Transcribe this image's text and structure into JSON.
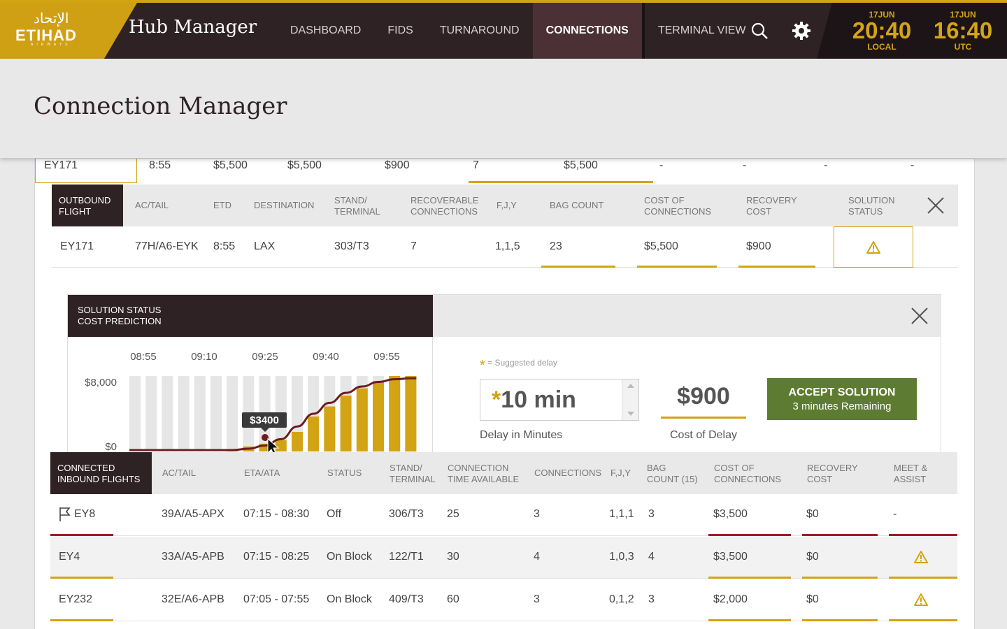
{
  "header": {
    "logo_arabic": "الإتحاد",
    "logo_text": "ETIHAD",
    "logo_sub": "AIRWAYS",
    "app_title": "Hub Manager",
    "nav": [
      "DASHBOARD",
      "FIDS",
      "TURNAROUND",
      "CONNECTIONS",
      "TERMINAL VIEW"
    ],
    "active_nav": "CONNECTIONS",
    "icons": [
      "search-icon",
      "gear-icon"
    ],
    "clocks": [
      {
        "date": "17JUN",
        "time": "20:40",
        "zone": "LOCAL"
      },
      {
        "date": "17JUN",
        "time": "16:40",
        "zone": "UTC"
      }
    ]
  },
  "page": {
    "title": "Connection Manager"
  },
  "summary_row": [
    "EY171",
    "8:55",
    "$5,500",
    "$5,500",
    "$900",
    "7",
    "$5,500",
    "-",
    "-",
    "-",
    "-"
  ],
  "outbound": {
    "label": [
      "OUTBOUND",
      "FLIGHT"
    ],
    "headers": [
      [
        "AC/TAIL"
      ],
      [
        "ETD"
      ],
      [
        "DESTINATION"
      ],
      [
        "STAND/",
        "TERMINAL"
      ],
      [
        "RECOVERABLE",
        "CONNECTIONS"
      ],
      [
        "F,J,Y"
      ],
      [
        "BAG COUNT"
      ],
      [
        "COST OF",
        "CONNECTIONS"
      ],
      [
        "RECOVERY",
        "COST"
      ],
      [
        "SOLUTION",
        "STATUS"
      ]
    ],
    "row": [
      "EY171",
      "77H/A6-EYK",
      "8:55",
      "LAX",
      "303/T3",
      "7",
      "1,1,5",
      "23",
      "$5,500",
      "$900"
    ],
    "status_icon": "warning-icon"
  },
  "prediction": {
    "title": [
      "SOLUTION STATUS",
      "COST PREDICTION"
    ],
    "suggested_note": "= Suggested delay",
    "delay_value": "10 min",
    "delay_star": "*",
    "delay_label": "Delay in Minutes",
    "cost_value": "$900",
    "cost_label": "Cost of Delay",
    "accept_label": "ACCEPT SOLUTION",
    "accept_sub": "3 minutes Remaining",
    "tooltip": "$3400"
  },
  "chart_data": {
    "type": "bar",
    "categories": [
      "08:55",
      "09:10",
      "09:25",
      "09:40",
      "09:55"
    ],
    "y_tick_labels": [
      "$8,000",
      "$0"
    ],
    "ylim": [
      0,
      8000
    ],
    "bar_values": [
      0,
      0,
      0,
      0,
      0,
      0,
      100,
      400,
      700,
      1100,
      2000,
      3700,
      4800,
      6000,
      6800,
      7600,
      8200,
      8600
    ],
    "curve_values": [
      0,
      0,
      0,
      0,
      0,
      0,
      0,
      150,
      500,
      1200,
      2600,
      4000,
      5200,
      6300,
      7000,
      7500,
      7800,
      7900
    ],
    "grid": false,
    "highlight": {
      "label": "$3400"
    }
  },
  "inbound": {
    "label": [
      "CONNECTED",
      "INBOUND FLIGHTS"
    ],
    "headers": [
      [
        "AC/TAIL"
      ],
      [
        "ETA/ATA"
      ],
      [
        "STATUS"
      ],
      [
        "STAND/",
        "TERMINAL"
      ],
      [
        "CONNECTION",
        "TIME AVAILABLE"
      ],
      [
        "CONNECTIONS"
      ],
      [
        "F,J,Y"
      ],
      [
        "BAG",
        "COUNT (15)"
      ],
      [
        "COST OF",
        "CONNECTIONS"
      ],
      [
        "RECOVERY",
        "COST"
      ],
      [
        "MEET &",
        "ASSIST"
      ]
    ],
    "rows": [
      {
        "flight": "EY8",
        "tail": "39A/A5-APX",
        "eta": "07:15 - 08:30",
        "status": "Off",
        "stand": "306/T3",
        "time": "25",
        "conn": "3",
        "fjy": "1,1,1",
        "bags": "3",
        "cost": "$3,500",
        "recovery": "$0",
        "assist": "-",
        "flag": true,
        "color": "red"
      },
      {
        "flight": "EY4",
        "tail": "33A/A5-APB",
        "eta": "07:15 - 08:25",
        "status": "On Block",
        "stand": "122/T1",
        "time": "30",
        "conn": "4",
        "fjy": "1,0,3",
        "bags": "4",
        "cost": "$3,500",
        "recovery": "$0",
        "assist": "",
        "flag": false,
        "color": "gold"
      },
      {
        "flight": "EY232",
        "tail": "32E/A6-APB",
        "eta": "07:05 - 07:55",
        "status": "On Block",
        "stand": "409/T3",
        "time": "60",
        "conn": "3",
        "fjy": "0,1,2",
        "bags": "3",
        "cost": "$2,000",
        "recovery": "$0",
        "assist": "",
        "flag": false,
        "color": "gold"
      }
    ]
  },
  "colors": {
    "brand_gold": "#d2a313",
    "dark": "#2f2225",
    "accept_green": "#5e7c31",
    "alert_red": "#a01f1f"
  }
}
